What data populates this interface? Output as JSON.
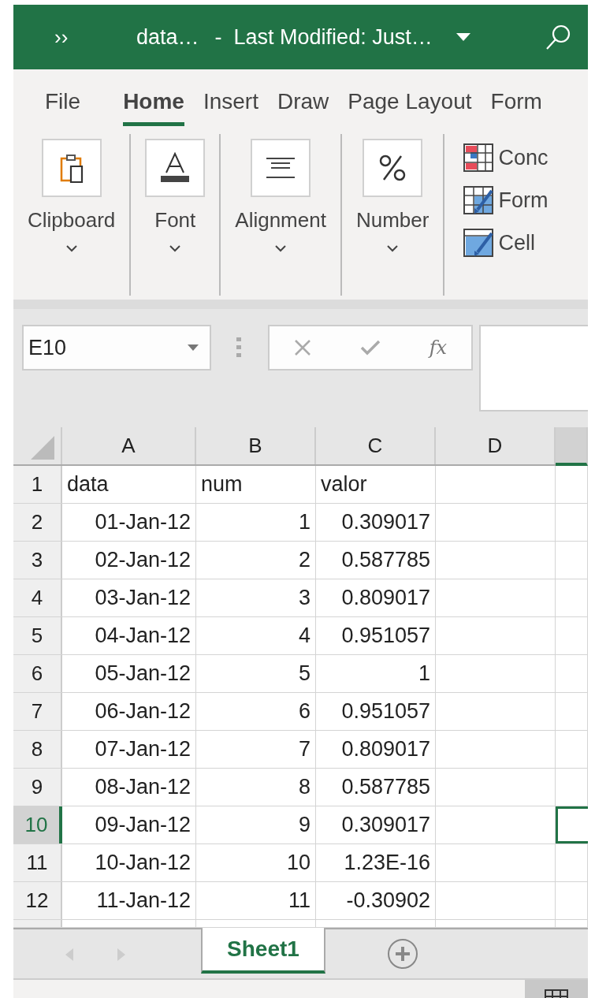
{
  "title_bar": {
    "overflow": "››",
    "file_name": "data…",
    "modified": "-  Last Modified: Just…"
  },
  "menu_tabs": [
    {
      "label": "File",
      "selected": false
    },
    {
      "label": "Home",
      "selected": true
    },
    {
      "label": "Insert",
      "selected": false
    },
    {
      "label": "Draw",
      "selected": false
    },
    {
      "label": "Page Layout",
      "selected": false
    },
    {
      "label": "Form",
      "selected": false
    }
  ],
  "ribbon_groups": [
    {
      "label": "Clipboard",
      "kind": "clipboard"
    },
    {
      "label": "Font",
      "kind": "font"
    },
    {
      "label": "Alignment",
      "kind": "alignment"
    },
    {
      "label": "Number",
      "kind": "number"
    }
  ],
  "style_items": [
    {
      "label": "Conc",
      "kind": "conditional"
    },
    {
      "label": "Form",
      "kind": "format"
    },
    {
      "label": "Cell",
      "kind": "cell"
    }
  ],
  "formula_bar": {
    "name_box": "E10",
    "function_label": "fx"
  },
  "columns": [
    {
      "label": "A",
      "selected": false
    },
    {
      "label": "B",
      "selected": false
    },
    {
      "label": "C",
      "selected": false
    },
    {
      "label": "D",
      "selected": false
    },
    {
      "selected": true
    }
  ],
  "rows": [
    {
      "number": "1",
      "kind": "text",
      "selected": false,
      "cells": [
        "data",
        "num",
        "valor"
      ]
    },
    {
      "number": "2",
      "kind": "number",
      "selected": false,
      "cells": [
        "01-Jan-12",
        "1",
        "0.309017"
      ]
    },
    {
      "number": "3",
      "kind": "number",
      "selected": false,
      "cells": [
        "02-Jan-12",
        "2",
        "0.587785"
      ]
    },
    {
      "number": "4",
      "kind": "number",
      "selected": false,
      "cells": [
        "03-Jan-12",
        "3",
        "0.809017"
      ]
    },
    {
      "number": "5",
      "kind": "number",
      "selected": false,
      "cells": [
        "04-Jan-12",
        "4",
        "0.951057"
      ]
    },
    {
      "number": "6",
      "kind": "number",
      "selected": false,
      "cells": [
        "05-Jan-12",
        "5",
        "1"
      ]
    },
    {
      "number": "7",
      "kind": "number",
      "selected": false,
      "cells": [
        "06-Jan-12",
        "6",
        "0.951057"
      ]
    },
    {
      "number": "8",
      "kind": "number",
      "selected": false,
      "cells": [
        "07-Jan-12",
        "7",
        "0.809017"
      ]
    },
    {
      "number": "9",
      "kind": "number",
      "selected": false,
      "cells": [
        "08-Jan-12",
        "8",
        "0.587785"
      ]
    },
    {
      "number": "10",
      "kind": "number",
      "selected": true,
      "cells": [
        "09-Jan-12",
        "9",
        "0.309017"
      ]
    },
    {
      "number": "11",
      "kind": "number",
      "selected": false,
      "cells": [
        "10-Jan-12",
        "10",
        "1.23E-16"
      ]
    },
    {
      "number": "12",
      "kind": "number",
      "selected": false,
      "cells": [
        "11-Jan-12",
        "11",
        "-0.30902"
      ]
    }
  ],
  "sheet_tabs": [
    {
      "label": "Sheet1",
      "selected": true
    }
  ]
}
